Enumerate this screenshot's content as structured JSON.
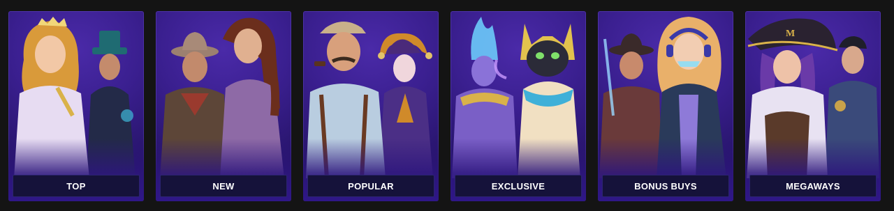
{
  "categories": [
    {
      "label": "TOP",
      "art": "goddess-and-magician-art"
    },
    {
      "label": "NEW",
      "art": "adventurers-art"
    },
    {
      "label": "POPULAR",
      "art": "detective-and-jester-art"
    },
    {
      "label": "EXCLUSIVE",
      "art": "egyptian-cat-and-god-art"
    },
    {
      "label": "BONUS BUYS",
      "art": "gamer-girl-and-cowboy-art"
    },
    {
      "label": "MEGAWAYS",
      "art": "pirate-and-hero-art"
    }
  ],
  "colors": {
    "page_background": "#141414",
    "card_background": "#3a1f8f",
    "label_bar": "#15123a",
    "label_text": "#ffffff"
  }
}
